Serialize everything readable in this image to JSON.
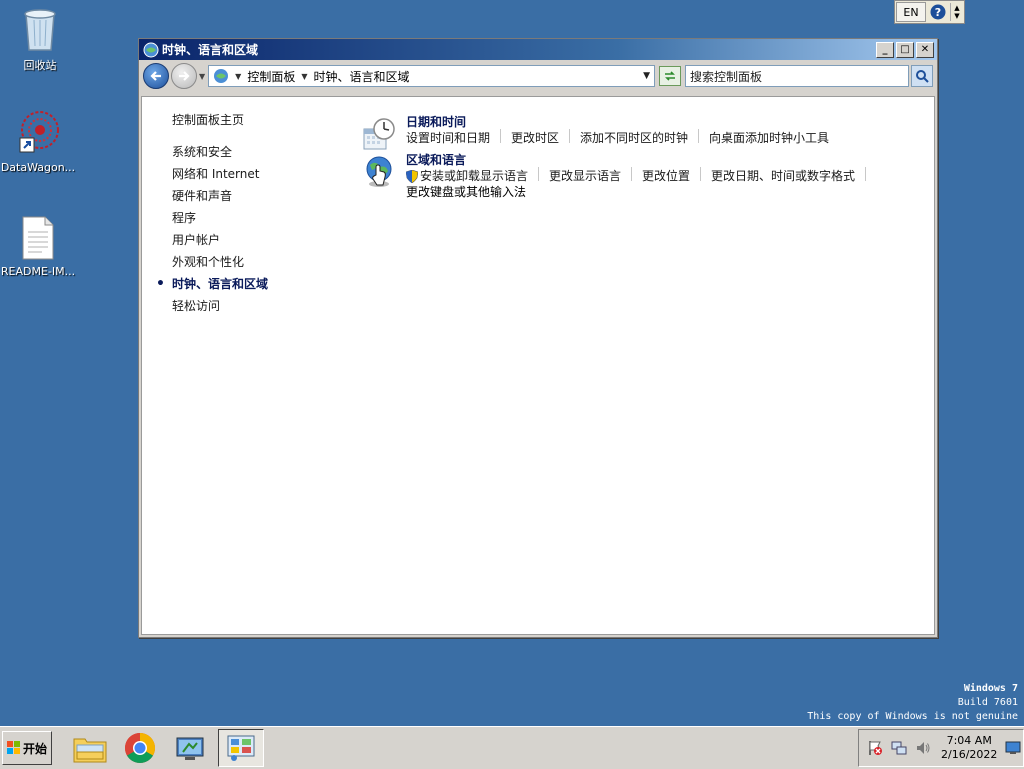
{
  "desktop": {
    "icons": [
      {
        "label": "回收站",
        "icon": "recycle-bin-icon"
      },
      {
        "label": "DataWagon...",
        "icon": "datawagon-shortcut-icon"
      },
      {
        "label": "README-IM...",
        "icon": "text-file-icon"
      }
    ]
  },
  "langbar": {
    "lang": "EN"
  },
  "window": {
    "title": "时钟、语言和区域",
    "address": {
      "crumbs": [
        "控制面板",
        "时钟、语言和区域"
      ]
    },
    "search": {
      "placeholder": "搜索控制面板"
    },
    "left_nav": {
      "home": "控制面板主页",
      "items": [
        "系统和安全",
        "网络和 Internet",
        "硬件和声音",
        "程序",
        "用户帐户",
        "外观和个性化",
        "时钟、语言和区域",
        "轻松访问"
      ],
      "current": "时钟、语言和区域"
    },
    "categories": [
      {
        "title": "日期和时间",
        "icon": "clock-calendar-icon",
        "links": [
          "设置时间和日期",
          "更改时区",
          "添加不同时区的时钟",
          "向桌面添加时钟小工具"
        ]
      },
      {
        "title": "区域和语言",
        "icon": "globe-icon",
        "links": [
          "安装或卸载显示语言",
          "更改显示语言",
          "更改位置",
          "更改日期、时间或数字格式"
        ],
        "links_line2": "更改键盘或其他输入法"
      }
    ]
  },
  "watermark": {
    "line1": "Windows 7",
    "line2": "Build 7601",
    "line3": "This copy of Windows is not genuine"
  },
  "taskbar": {
    "start_label": "开始",
    "buttons": [
      "explorer-icon",
      "chrome-icon",
      "remote-desktop-icon",
      "control-panel-icon"
    ],
    "clock": {
      "time": "7:04 AM",
      "date": "2/16/2022"
    }
  }
}
